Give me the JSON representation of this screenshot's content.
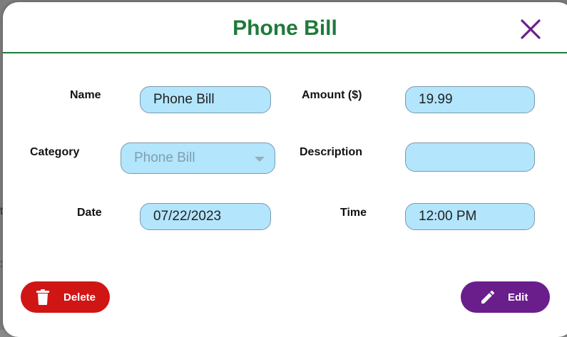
{
  "dialog": {
    "title": "Phone Bill",
    "close_icon": "close-icon"
  },
  "form": {
    "name": {
      "label": "Name",
      "value": "Phone Bill"
    },
    "amount": {
      "label": "Amount ($)",
      "value": "19.99"
    },
    "category": {
      "label": "Category",
      "value": "Phone Bill"
    },
    "description": {
      "label": "Description",
      "value": ""
    },
    "date": {
      "label": "Date",
      "value": "07/22/2023"
    },
    "time": {
      "label": "Time",
      "value": "12:00 PM"
    }
  },
  "actions": {
    "delete_label": "Delete",
    "edit_label": "Edit"
  },
  "colors": {
    "title": "#1f7a3a",
    "close": "#6a1e8c",
    "field_bg": "#b3e5fc",
    "delete": "#d01515",
    "edit": "#6a1e8c"
  }
}
